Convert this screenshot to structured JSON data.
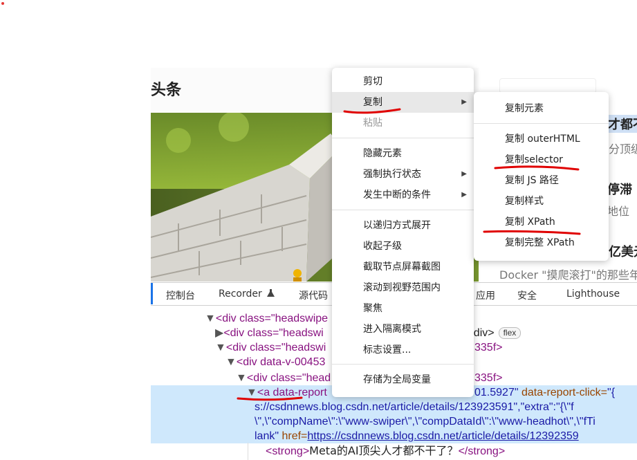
{
  "page": {
    "title": "头条"
  },
  "news": {
    "headline_1": "才都不",
    "sub_1": "分顶级",
    "headline_2": "停滞",
    "sub_2": "地位",
    "headline_3": "亿美元",
    "sub_3": "Docker \"摸爬滚打\"的那些年"
  },
  "devtools": {
    "tabs": [
      {
        "label": "控制台"
      },
      {
        "label": "Recorder"
      },
      {
        "label": "源代码"
      },
      {
        "label": "应用"
      },
      {
        "label": "安全"
      },
      {
        "label": "Lighthouse"
      }
    ],
    "dom": {
      "r0_tag": "<div class=\"headswipe",
      "r1_tag": "<div class=\"headswi",
      "r1_tail": "…</div>",
      "r1_badge": "flex",
      "r2_tag": "<div class=\"headswi",
      "r2_tail": "335f>",
      "r3_tag": "<div data-v-00453",
      "r4_tag": "<div class=\"head",
      "r4_tail": "335f>",
      "r5_tag": "<a data-report",
      "r5_mid": "01.5927\"",
      "r5_attr": "data-report-click=",
      "r5_val": "\"{",
      "r6": "s://csdnnews.blog.csdn.net/article/details/123923591\",\"extra\":\"{\\\"f",
      "r7": "\\\",\\\"compName\\\":\\\"www-swiper\\\",\\\"compDataId\\\":\\\"www-headhot\\\",\\\"fTi",
      "r8_pre": "lank\"",
      "r8_attr": "href=",
      "r8_link": "https://csdnnews.blog.csdn.net/article/details/12392359",
      "r9_open": "<strong>",
      "r9_text": "Meta的AI顶尖人才都不干了？",
      "r9_close": "</strong>"
    }
  },
  "context_menu": {
    "items": [
      {
        "label": "剪切"
      },
      {
        "label": "复制"
      },
      {
        "label": "粘贴"
      },
      {
        "label": "隐藏元素"
      },
      {
        "label": "强制执行状态"
      },
      {
        "label": "发生中断的条件"
      },
      {
        "label": "以递归方式展开"
      },
      {
        "label": "收起子级"
      },
      {
        "label": "截取节点屏幕截图"
      },
      {
        "label": "滚动到视野范围内"
      },
      {
        "label": "聚焦"
      },
      {
        "label": "进入隔离模式"
      },
      {
        "label": "标志设置..."
      },
      {
        "label": "存储为全局变量"
      }
    ],
    "arrow": "▶"
  },
  "copy_submenu": {
    "items": [
      {
        "label": "复制元素"
      },
      {
        "label": "复制 outerHTML"
      },
      {
        "label": "复制selector"
      },
      {
        "label": "复制 JS 路径"
      },
      {
        "label": "复制样式"
      },
      {
        "label": "复制 XPath"
      },
      {
        "label": "复制完整 XPath"
      }
    ]
  },
  "colors": {
    "annotation": "#e00000",
    "selection": "#cfe8fc",
    "menu_highlight": "#e8e8e8"
  },
  "icons": {
    "recorder": "flask-icon",
    "expand": "triangle-down-icon",
    "collapsed": "triangle-right-icon"
  }
}
